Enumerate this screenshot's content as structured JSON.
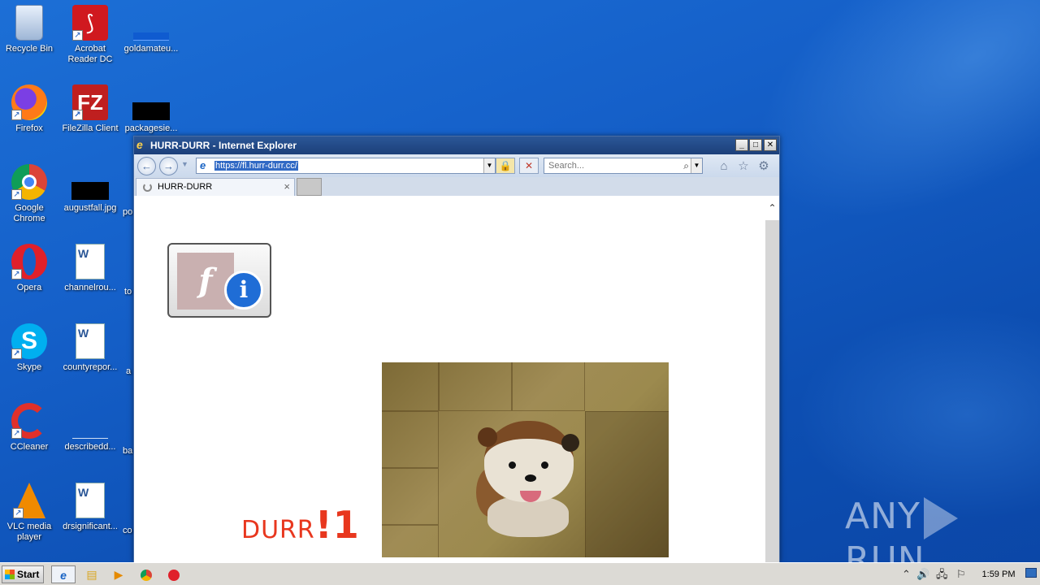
{
  "desktop": {
    "icons": [
      {
        "label": "Recycle Bin",
        "icon": "recycle-bin-icon"
      },
      {
        "label": "Acrobat Reader DC",
        "icon": "acrobat-icon"
      },
      {
        "label": "goldamateu...",
        "icon": "file-icon"
      },
      {
        "label": "Firefox",
        "icon": "firefox-icon"
      },
      {
        "label": "FileZilla Client",
        "icon": "filezilla-icon"
      },
      {
        "label": "packagesie...",
        "icon": "file-icon"
      },
      {
        "label": "Google Chrome",
        "icon": "chrome-icon"
      },
      {
        "label": "augustfall.jpg",
        "icon": "image-file-icon"
      },
      {
        "label": "Opera",
        "icon": "opera-icon"
      },
      {
        "label": "channelrou...",
        "icon": "word-doc-icon"
      },
      {
        "label": "Skype",
        "icon": "skype-icon"
      },
      {
        "label": "countyrepor...",
        "icon": "word-doc-icon"
      },
      {
        "label": "CCleaner",
        "icon": "ccleaner-icon"
      },
      {
        "label": "describedd...",
        "icon": "file-icon"
      },
      {
        "label": "VLC media player",
        "icon": "vlc-icon"
      },
      {
        "label": "drsignificant...",
        "icon": "word-doc-icon"
      }
    ],
    "partial_labels": [
      "po",
      "to",
      "a",
      "ba",
      "co"
    ]
  },
  "window": {
    "title": "HURR-DURR - Internet Explorer",
    "controls": {
      "minimize": "_",
      "maximize": "□",
      "close": "✕"
    },
    "address": "https://fl.hurr-durr.cc/",
    "search_placeholder": "Search...",
    "tab_title": "HURR-DURR"
  },
  "page": {
    "durr_text": "DURR",
    "durr_suffix": "!1",
    "flash_letter": "f",
    "info_letter": "i"
  },
  "taskbar": {
    "start_label": "Start",
    "time": "1:59 PM"
  },
  "watermark": {
    "left": "ANY",
    "right": "RUN"
  }
}
